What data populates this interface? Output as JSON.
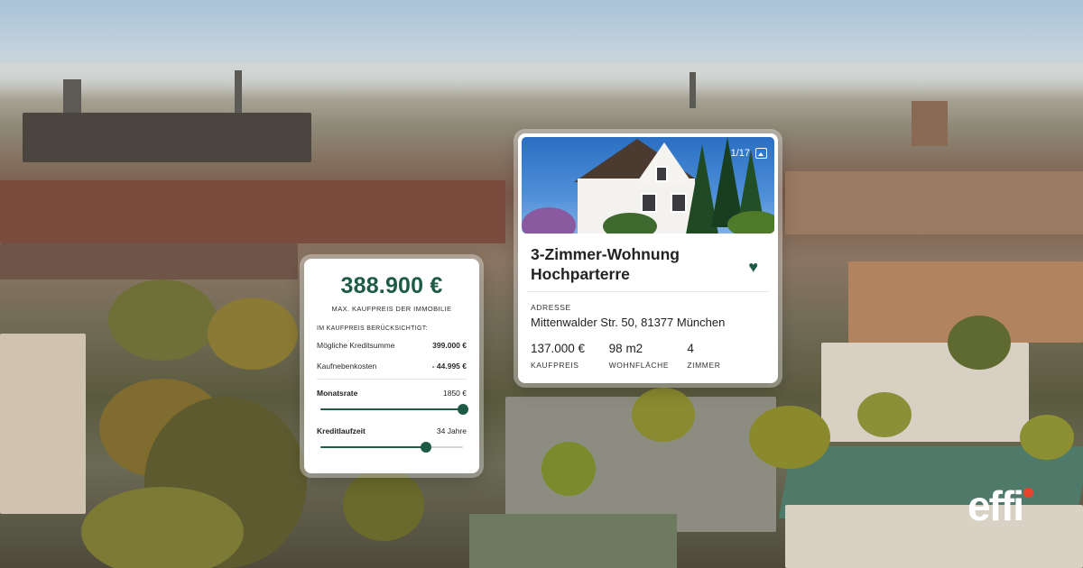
{
  "price_card": {
    "price": "388.900 €",
    "price_caption": "MAX. KAUFPREIS DER IMMOBILIE",
    "included_label": "IM KAUFPREIS BERÜCKSICHTIGT:",
    "rows": [
      {
        "label": "Mögliche Kreditsumme",
        "value": "399.000 €"
      },
      {
        "label": "Kaufnebenkosten",
        "value": "- 44.995 €"
      }
    ],
    "monthly_rate": {
      "label": "Monatsrate",
      "value": "1850 €",
      "slider_fraction": 1.0
    },
    "term": {
      "label": "Kreditlaufzeit",
      "value": "34 Jahre",
      "slider_fraction": 0.74
    }
  },
  "listing": {
    "photo_counter": "1/17",
    "title": "3-Zimmer-Wohnung Hochparterre",
    "favorite_icon": "heart-icon",
    "address_label": "ADRESSE",
    "address": "Mittenwalder Str. 50, 81377 München",
    "stats": [
      {
        "value": "137.000 €",
        "label": "KAUFPREIS"
      },
      {
        "value": "98 m2",
        "label": "WOHNFLÄCHE"
      },
      {
        "value": "4",
        "label": "ZIMMER"
      }
    ]
  },
  "brand": {
    "logo_text": "effi",
    "accent": "#1e5b45",
    "logo_dot": "#e8442c"
  }
}
